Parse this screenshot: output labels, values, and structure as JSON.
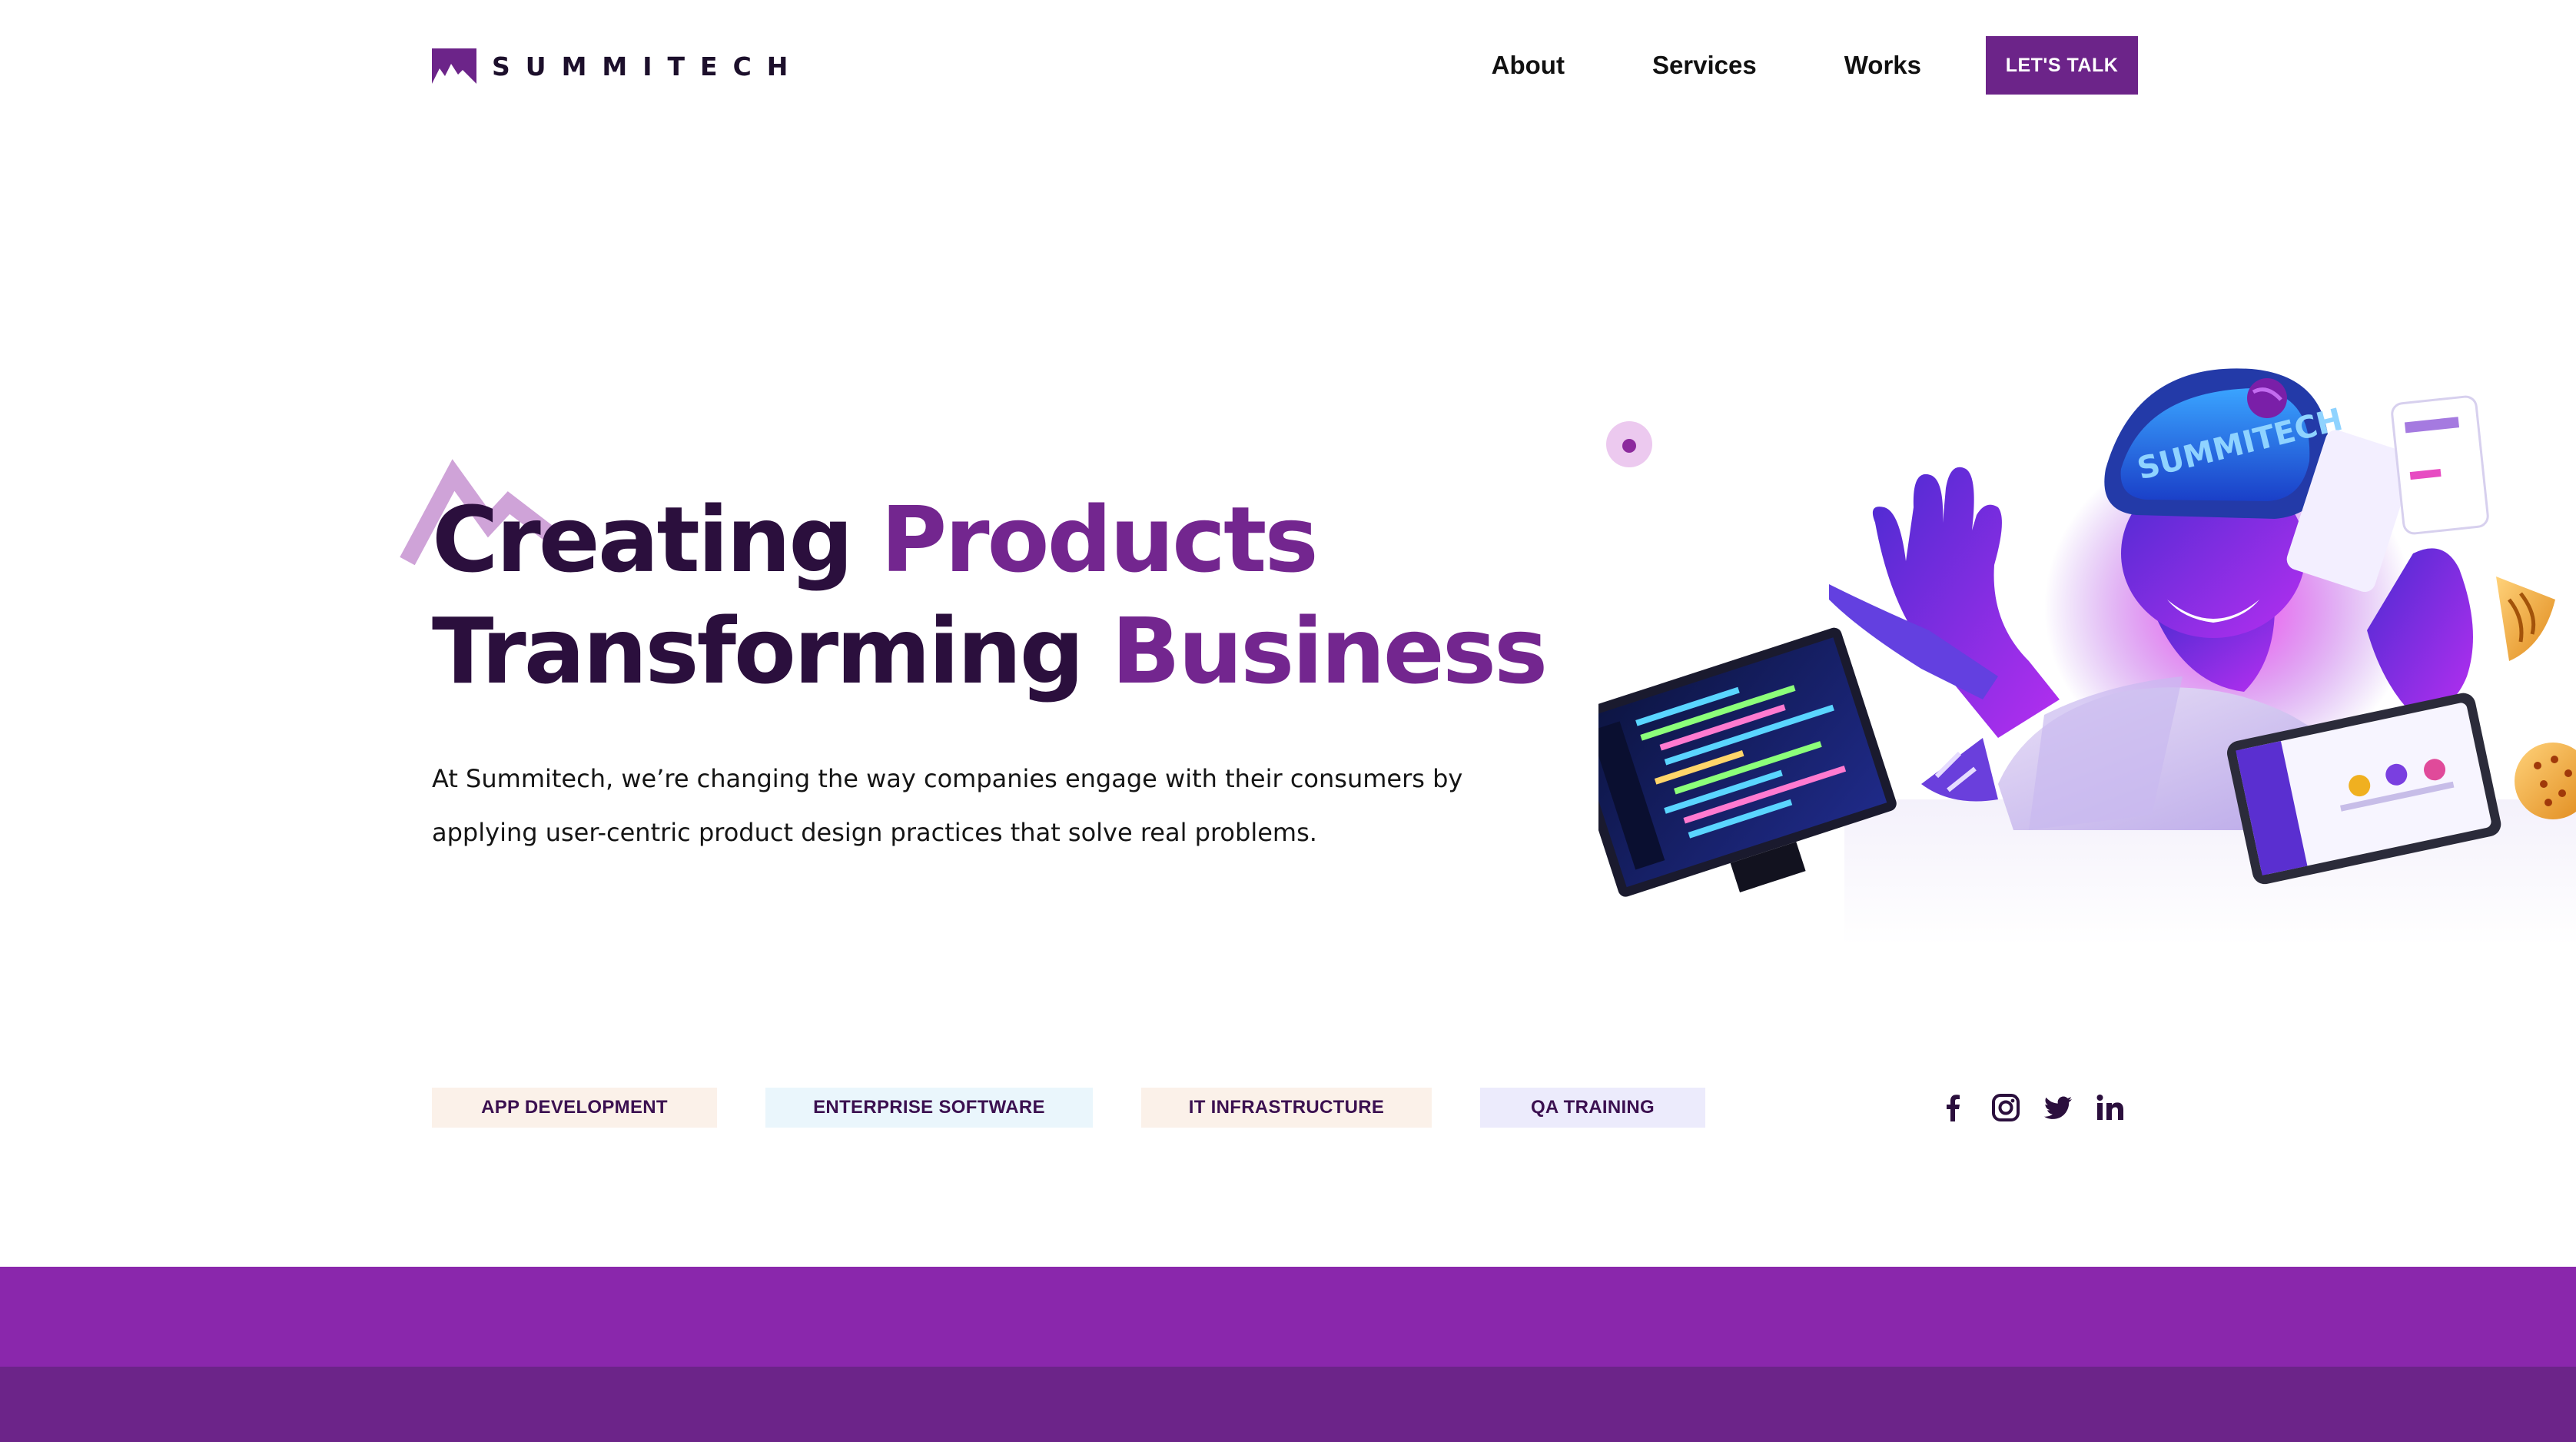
{
  "header": {
    "brand": "SUMMITECH",
    "nav": [
      {
        "label": "About"
      },
      {
        "label": "Services"
      },
      {
        "label": "Works"
      }
    ],
    "cta_label": "LET'S TALK"
  },
  "hero": {
    "title_line1_dark": "Creating",
    "title_line1_accent": "Products",
    "title_line2_dark": "Transforming",
    "title_line2_accent": "Business",
    "description": "At Summitech, we’re changing the way companies engage with their consumers by applying user-centric product design practices that solve real problems.",
    "vr_headset_text": "SUMMITECH"
  },
  "tags": [
    {
      "label": "APP DEVELOPMENT"
    },
    {
      "label": "ENTERPRISE SOFTWARE"
    },
    {
      "label": "IT INFRASTRUCTURE"
    },
    {
      "label": "QA TRAINING"
    }
  ],
  "social": [
    {
      "icon": "facebook-icon"
    },
    {
      "icon": "instagram-icon"
    },
    {
      "icon": "twitter-icon"
    },
    {
      "icon": "linkedin-icon"
    }
  ],
  "colors": {
    "brand_purple": "#6c2489",
    "accent_purple": "#73268f",
    "title_dark": "#2b0f3d",
    "band_light": "#8a27ac",
    "band_dark": "#6c2489",
    "tag_peach": "#fbf1e9",
    "tag_blue": "#eaf6fc",
    "tag_lavender": "#ecebfc"
  }
}
